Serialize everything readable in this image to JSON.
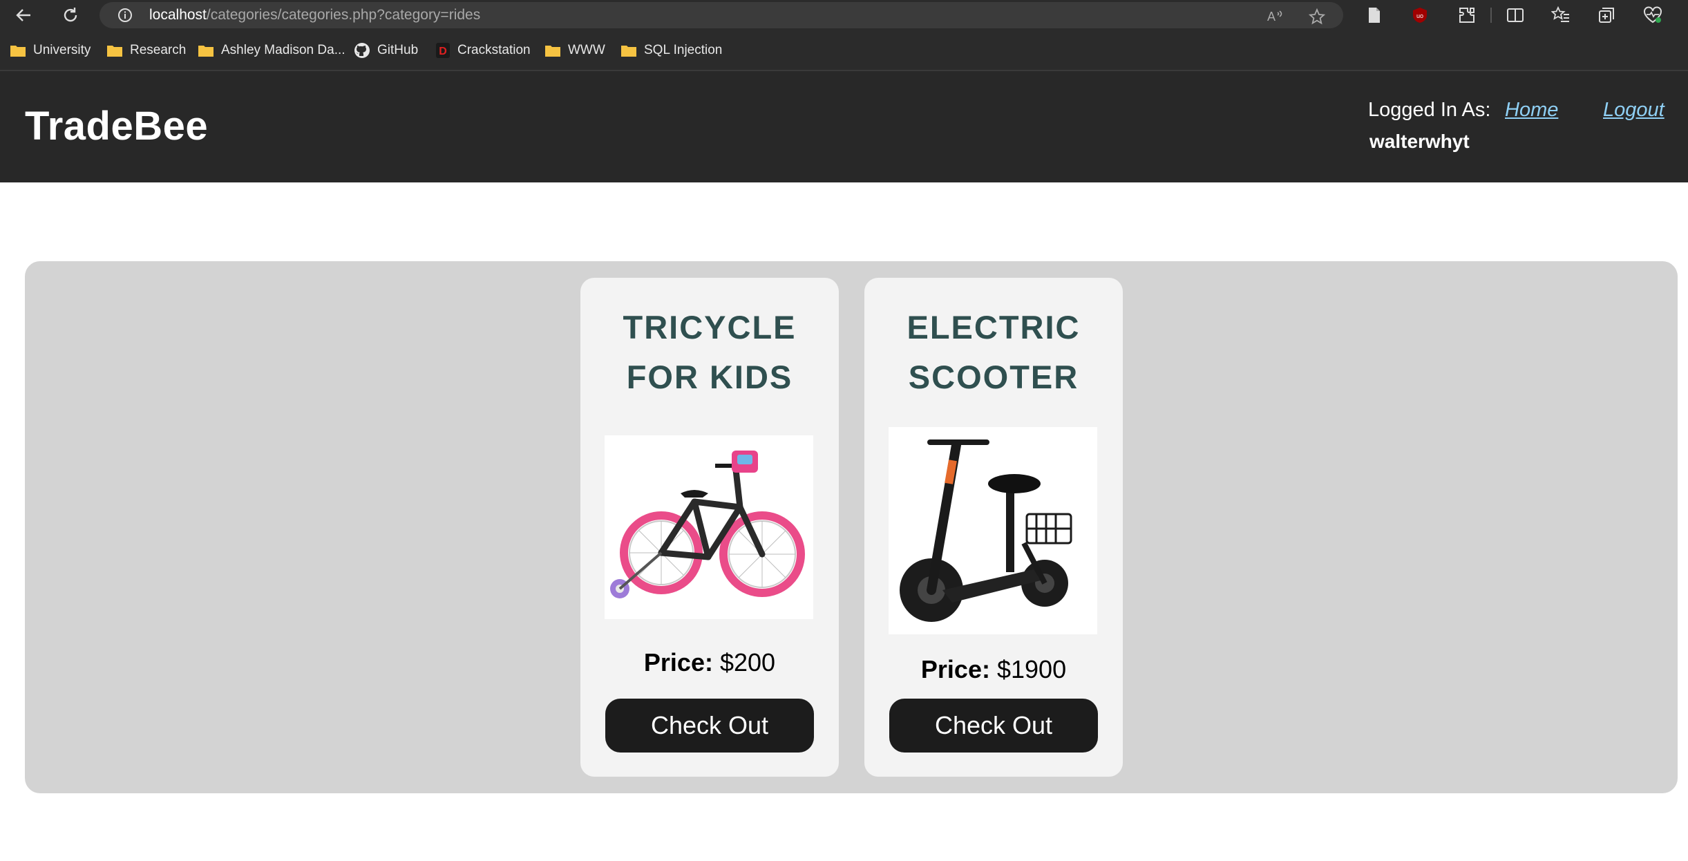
{
  "browser": {
    "url_host": "localhost",
    "url_path": "/categories/categories.php?category=rides",
    "bookmarks": [
      {
        "label": "University",
        "icon": "folder-icon"
      },
      {
        "label": "Research",
        "icon": "folder-icon"
      },
      {
        "label": "Ashley Madison Da...",
        "icon": "folder-icon"
      },
      {
        "label": "GitHub",
        "icon": "github-icon"
      },
      {
        "label": "Crackstation",
        "icon": "crackstation-icon"
      },
      {
        "label": "WWW",
        "icon": "folder-icon"
      },
      {
        "label": "SQL Injection",
        "icon": "folder-icon"
      }
    ]
  },
  "header": {
    "logo": "TradeBee",
    "logged_in_label": "Logged In As:",
    "username": "walterwhyt",
    "home_link": "Home",
    "logout_link": "Logout"
  },
  "products": [
    {
      "title_line1": "TRICYCLE",
      "title_line2": "FOR KIDS",
      "price_label": "Price:",
      "price_value": "$200",
      "button": "Check Out"
    },
    {
      "title_line1": "ELECTRIC",
      "title_line2": "SCOOTER",
      "price_label": "Price:",
      "price_value": "$1900",
      "button": "Check Out"
    }
  ],
  "colors": {
    "header_bg": "#282828",
    "panel_bg": "#d3d3d3",
    "card_bg": "#f3f3f3",
    "title_color": "#2f4f4f",
    "link_color": "#8fd0f5",
    "button_bg": "#1c1c1c"
  }
}
